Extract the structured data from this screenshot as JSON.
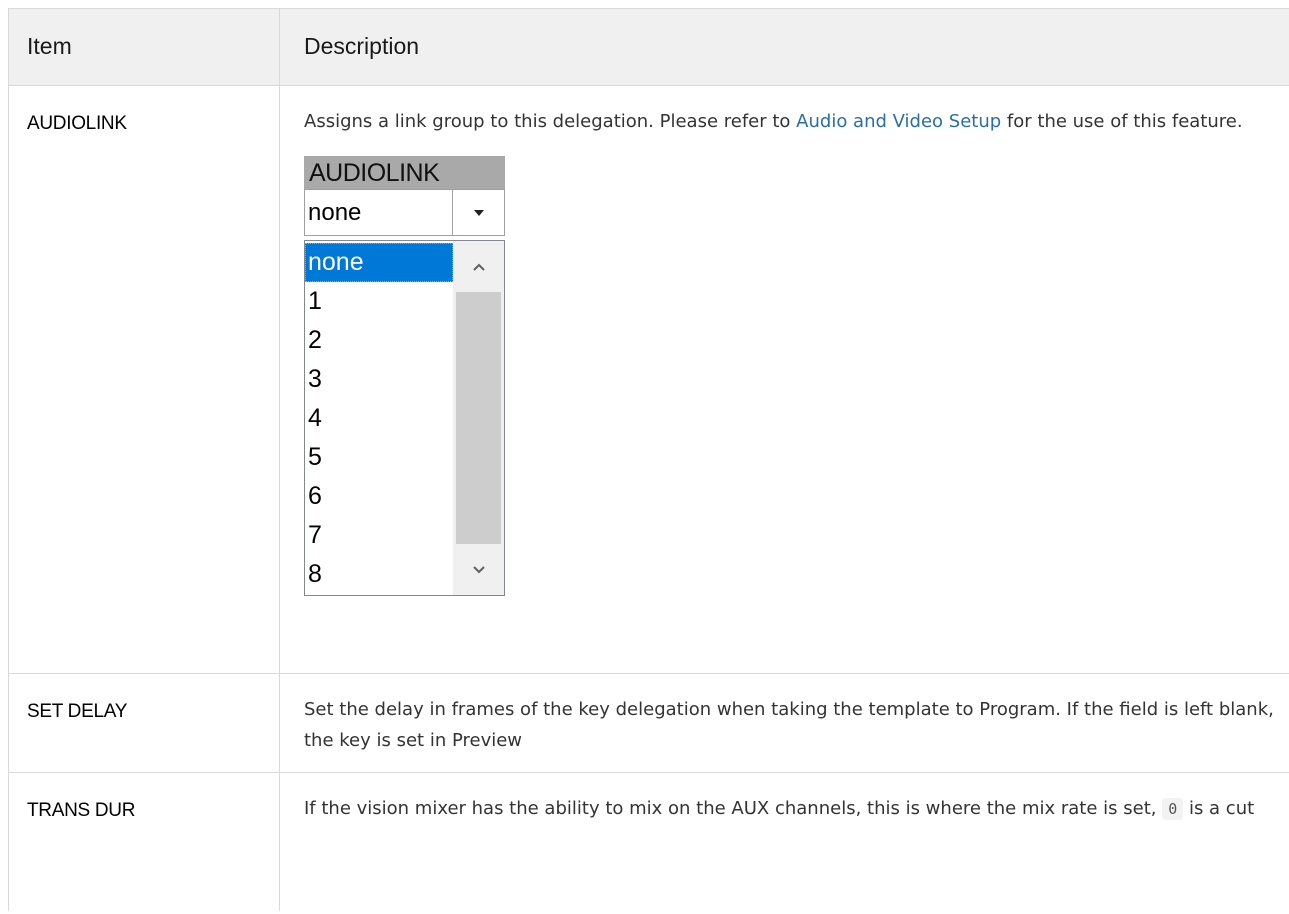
{
  "table": {
    "headers": {
      "item": "Item",
      "description": "Description"
    },
    "rows": {
      "audiolink": {
        "item": "AUDIOLINK",
        "desc_before": "Assigns a link group to this delegation. Please refer to ",
        "link_text": "Audio and Video Setup",
        "desc_after": " for the use of this feature."
      },
      "set_delay": {
        "item": "SET DELAY",
        "desc": "Set the delay in frames of the key delegation when taking the template to Program. If the field is left blank, the key is set in Preview"
      },
      "trans_dur": {
        "item": "TRANS DUR",
        "desc_before": "If the vision mixer has the ability to mix on the AUX channels, this is where the mix rate is set, ",
        "code": "0",
        "desc_after": " is a cut"
      }
    }
  },
  "widget": {
    "title": "AUDIOLINK",
    "selected_value": "none",
    "options": [
      "none",
      "1",
      "2",
      "3",
      "4",
      "5",
      "6",
      "7",
      "8"
    ],
    "highlighted_option": "none",
    "colors": {
      "selection": "#0078d7",
      "title_bar": "#a9a9a9",
      "link": "#2b6ea5"
    },
    "icons": {
      "dropdown": "chevron-down-icon",
      "scroll_up": "chevron-up-icon",
      "scroll_down": "chevron-down-icon"
    }
  }
}
